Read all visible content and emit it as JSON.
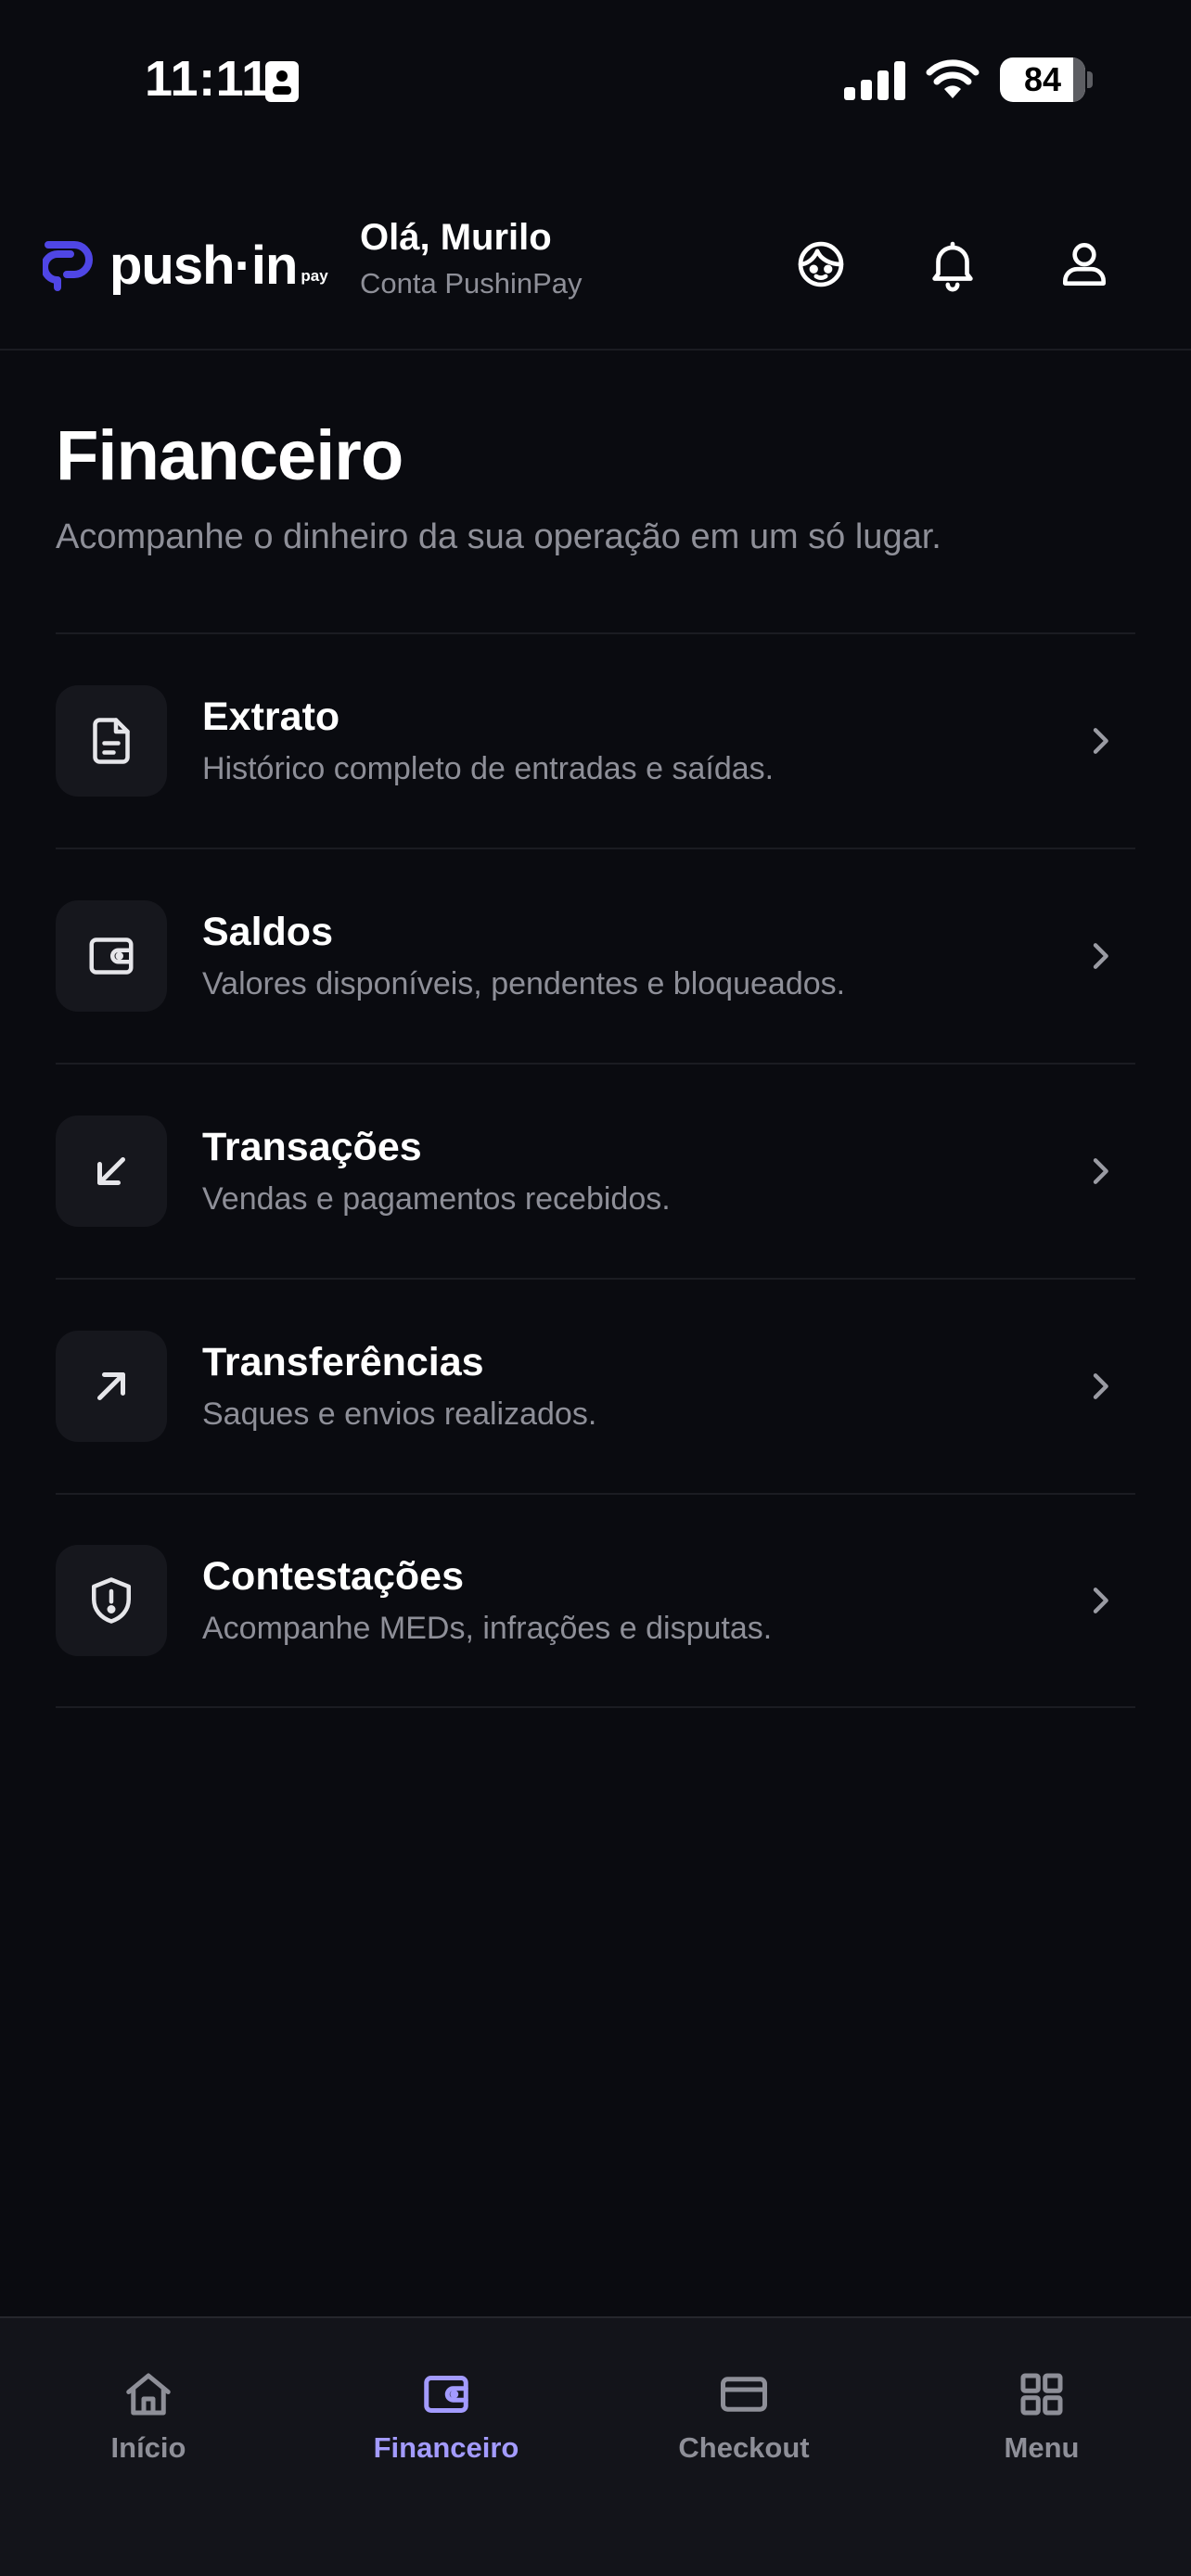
{
  "status_bar": {
    "time": "11:11",
    "battery_level": "84",
    "battery_percent": 86
  },
  "header": {
    "logo_text": "push·in",
    "logo_suffix": "pay",
    "greeting": "Olá, Murilo",
    "account": "Conta PushinPay"
  },
  "page": {
    "title": "Financeiro",
    "subtitle": "Acompanhe o dinheiro da sua operação em um só lugar."
  },
  "menu": {
    "items": [
      {
        "title": "Extrato",
        "description": "Histórico completo de entradas e saídas.",
        "icon": "document-icon"
      },
      {
        "title": "Saldos",
        "description": "Valores disponíveis, pendentes e bloqueados.",
        "icon": "wallet-icon"
      },
      {
        "title": "Transações",
        "description": "Vendas e pagamentos recebidos.",
        "icon": "arrow-down-left-icon"
      },
      {
        "title": "Transferências",
        "description": "Saques e envios realizados.",
        "icon": "arrow-up-right-icon"
      },
      {
        "title": "Contestações",
        "description": "Acompanhe MEDs, infrações e disputas.",
        "icon": "shield-alert-icon"
      }
    ]
  },
  "bottom_nav": {
    "items": [
      {
        "label": "Início",
        "icon": "home-icon"
      },
      {
        "label": "Financeiro",
        "icon": "wallet-icon",
        "active": true
      },
      {
        "label": "Checkout",
        "icon": "credit-card-icon"
      },
      {
        "label": "Menu",
        "icon": "grid-icon"
      }
    ]
  },
  "colors": {
    "background": "#0a0b10",
    "accent": "#a39bff",
    "logo_accent": "#4f46e5",
    "muted_text": "#8e8f98"
  }
}
